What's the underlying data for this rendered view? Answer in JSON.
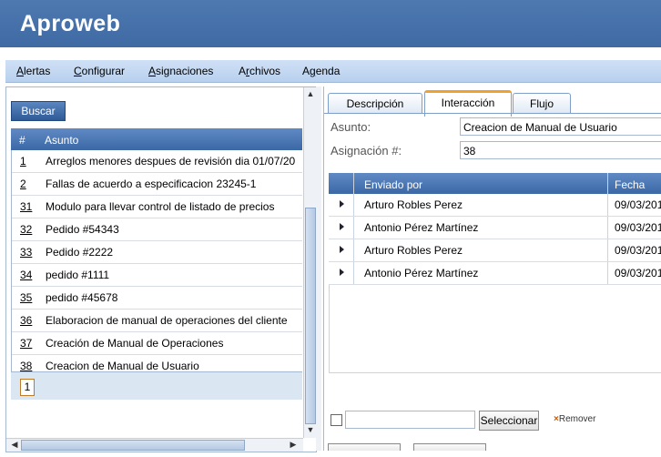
{
  "app": {
    "title": "Aproweb"
  },
  "menu": [
    {
      "label": "Alertas",
      "access": "A"
    },
    {
      "label": "Configurar",
      "access": "C"
    },
    {
      "label": "Asignaciones",
      "access": "A"
    },
    {
      "label": "Archivos",
      "access": "r"
    },
    {
      "label": "Agenda",
      "access": "g"
    }
  ],
  "left": {
    "search_label": "Buscar",
    "columns": {
      "num": "#",
      "asunto": "Asunto"
    },
    "rows": [
      {
        "num": "1",
        "asunto": "Arreglos menores despues de revisión dia 01/07/20"
      },
      {
        "num": "2",
        "asunto": "Fallas de acuerdo a especificacion 23245-1"
      },
      {
        "num": "31",
        "asunto": "Modulo para llevar control de listado de precios"
      },
      {
        "num": "32",
        "asunto": "Pedido #54343"
      },
      {
        "num": "33",
        "asunto": "Pedido #2222"
      },
      {
        "num": "34",
        "asunto": "pedido #1111"
      },
      {
        "num": "35",
        "asunto": "pedido #45678"
      },
      {
        "num": "36",
        "asunto": "Elaboracion de manual de operaciones del cliente"
      },
      {
        "num": "37",
        "asunto": "Creación de Manual de Operaciones"
      },
      {
        "num": "38",
        "asunto": "Creacion de Manual de Usuario"
      }
    ],
    "page": "1"
  },
  "right": {
    "tabs": [
      {
        "label": "Descripción",
        "active": false
      },
      {
        "label": "Interacción",
        "active": true
      },
      {
        "label": "Flujo",
        "active": false
      }
    ],
    "asunto_label": "Asunto:",
    "asunto_value": "Creacion de Manual de Usuario",
    "asignacion_label": "Asignación #:",
    "asignacion_value": "38",
    "grid_columns": {
      "enviado": "Enviado por",
      "fecha": "Fecha"
    },
    "grid_rows": [
      {
        "enviado": "Arturo Robles Perez",
        "fecha": "09/03/201"
      },
      {
        "enviado": "Antonio Pérez Martínez",
        "fecha": "09/03/201"
      },
      {
        "enviado": "Arturo Robles Perez",
        "fecha": "09/03/201"
      },
      {
        "enviado": "Antonio Pérez Martínez",
        "fecha": "09/03/201"
      }
    ],
    "select_label": "Seleccionar",
    "remove_label": "Remover"
  },
  "colors": {
    "header": "#4570a8",
    "menubar": "#c4d8f0",
    "grid_header": "#4a76b2",
    "active_tab": "#f0a030"
  },
  "icons": {
    "row_expand": "triangle-right-icon",
    "remove": "x-icon"
  }
}
